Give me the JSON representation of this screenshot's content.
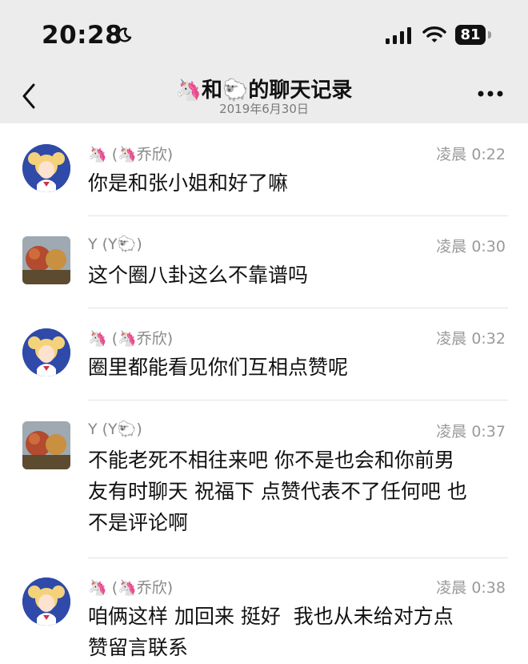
{
  "status_bar": {
    "time": "20:28",
    "battery": "81",
    "icons": [
      "moon-icon",
      "signal-icon",
      "wifi-icon",
      "battery-icon"
    ]
  },
  "header": {
    "title": "🦄和🐑的聊天记录",
    "date": "2019年6月30日",
    "back_icon": "chevron-left-icon",
    "more_icon": "more-icon"
  },
  "messages": [
    {
      "sender": "🦄 (🦄乔欣)",
      "time": "凌晨 0:22",
      "text": "你是和张小姐和好了嘛",
      "avatar": "sailor-moon-avatar"
    },
    {
      "sender": "Y (Y🐑)",
      "time": "凌晨 0:30",
      "text": "这个圈八卦这么不靠谱吗",
      "avatar": "y-avatar"
    },
    {
      "sender": "🦄 (🦄乔欣)",
      "time": "凌晨 0:32",
      "text": "圈里都能看见你们互相点赞呢",
      "avatar": "sailor-moon-avatar"
    },
    {
      "sender": "Y (Y🐑)",
      "time": "凌晨 0:37",
      "text": "不能老死不相往来吧 你不是也会和你前男\n友有时聊天 祝福下 点赞代表不了任何吧 也\n不是评论啊",
      "avatar": "y-avatar"
    },
    {
      "sender": "🦄 (🦄乔欣)",
      "time": "凌晨 0:38",
      "text": "咱俩这样 加回来 挺好  我也从未给对方点\n赞留言联系",
      "avatar": "sailor-moon-avatar"
    }
  ],
  "colors": {
    "top_background": "#ececec",
    "text": "#111111",
    "meta_text": "#888888",
    "divider": "#e3e3e3"
  }
}
